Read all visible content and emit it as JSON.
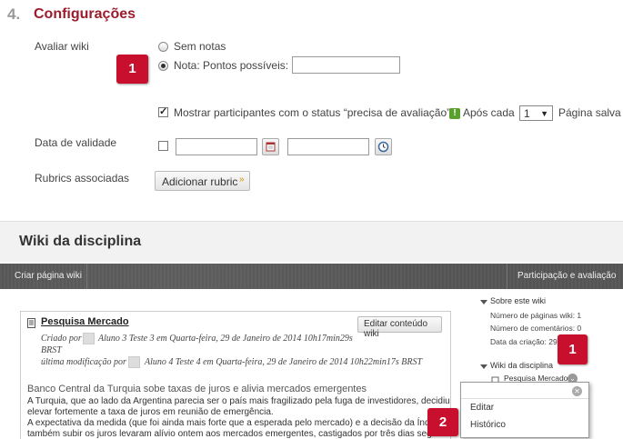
{
  "settings": {
    "section_number": "4.",
    "section_title": "Configurações",
    "grade_label": "Avaliar wiki",
    "no_grade_option": "Sem notas",
    "grade_option": "Nota: Pontos possíveis:",
    "points_value": "",
    "show_participants_label": "Mostrar participantes com o status “precisa de avaliação”",
    "after_each_label": "Após cada",
    "after_each_value": "1",
    "page_saved_label": "Página salva",
    "due_date_label": "Data de validade",
    "rubrics_label": "Rubrics associadas",
    "add_rubric_button": "Adicionar rubric"
  },
  "callouts": {
    "top": "1",
    "side": "1",
    "bottom": "2"
  },
  "wiki": {
    "title": "Wiki da disciplina",
    "toolbar": {
      "create_page": "Criar página wiki",
      "participation": "Participação e avaliação"
    },
    "entry": {
      "title": "Pesquisa Mercado",
      "edit_button": "Editar conteúdo wiki",
      "created_prefix": "Criado por",
      "created_by": "Aluno 3 Teste 3 em Quarta-feira, 29 de Janeiro de 2014 10h17min29s",
      "created_tz": "BRST",
      "modified_prefix": "última modificação por",
      "modified_by": "Aluno 4 Teste 4 em Quarta-feira, 29 de Janeiro de 2014 10h22min17s BRST",
      "article_title": "Banco Central da Turquia sobe taxas de juros e alivia mercados emergentes",
      "body_1": "A Turquia, que ao lado da Argentina parecia ser o país mais fragilizado pela fuga de investidores, decidiu",
      "body_2": "elevar fortemente a taxa de juros em reunião de emergência.",
      "body_3": "A expectativa da medida (que foi ainda mais forte que a esperada pelo mercado) e a decisão da Índia de",
      "body_4": "também subir os juros levaram alívio ontem aos mercados emergentes, castigados por três dias seguid"
    },
    "sidebar": {
      "about_title": "Sobre este wiki",
      "pages_count": "Número de páginas wiki: 1",
      "comments_count": "Número de comentários: 0",
      "created_date": "Data da criação: 29/",
      "wiki_title": "Wiki da disciplina",
      "page_link": "Pesquisa Mercado"
    },
    "menu": {
      "edit": "Editar",
      "history": "Histórico"
    }
  }
}
